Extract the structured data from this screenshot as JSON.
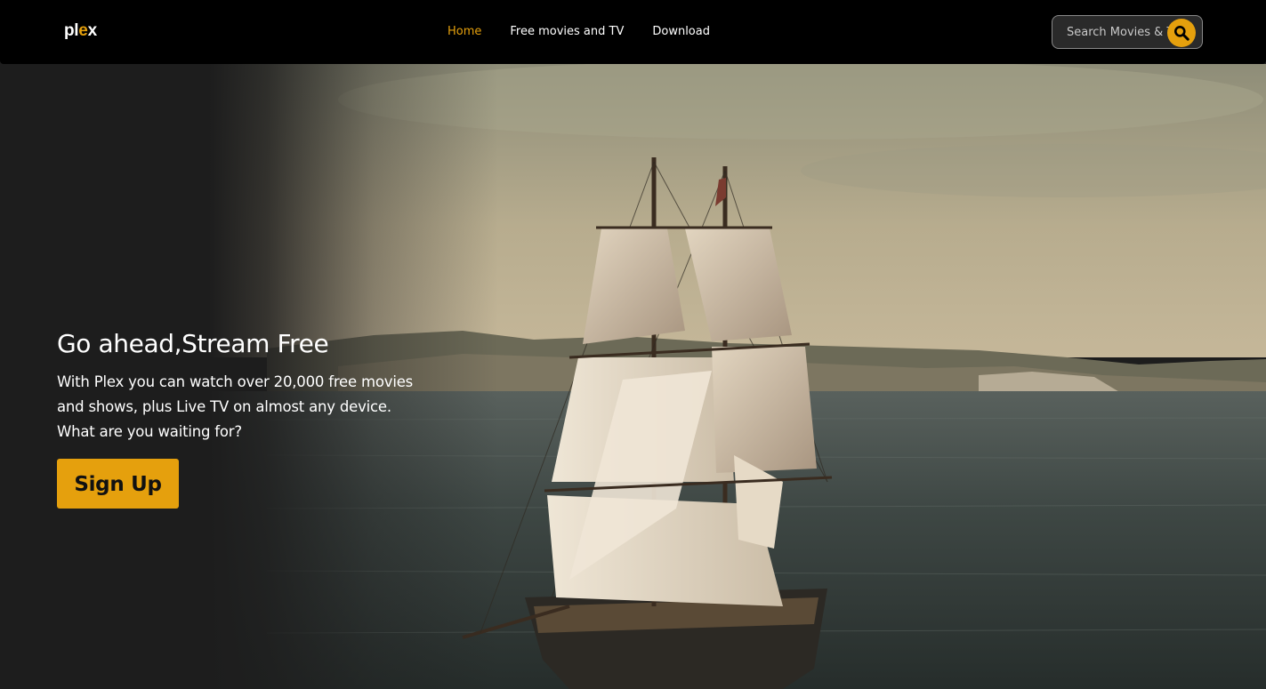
{
  "brand": {
    "logo_left": "pl",
    "logo_x": "e",
    "logo_right": "x"
  },
  "nav": {
    "items": [
      {
        "label": "Home",
        "active": true
      },
      {
        "label": "Free movies and TV",
        "active": false
      },
      {
        "label": "Download",
        "active": false
      }
    ]
  },
  "search": {
    "placeholder": "Search Movies & TV",
    "icon": "search-icon"
  },
  "hero": {
    "title": "Go ahead,Stream Free",
    "text": "With Plex you can watch over 20,000 free movies and shows, plus Live TV on almost any device. What are you waiting for?",
    "cta_label": "Sign Up",
    "background_image": "sailing-ship-at-sea"
  },
  "colors": {
    "accent": "#e5a00d",
    "navbar": "#000000",
    "page": "#1d1d1d"
  }
}
